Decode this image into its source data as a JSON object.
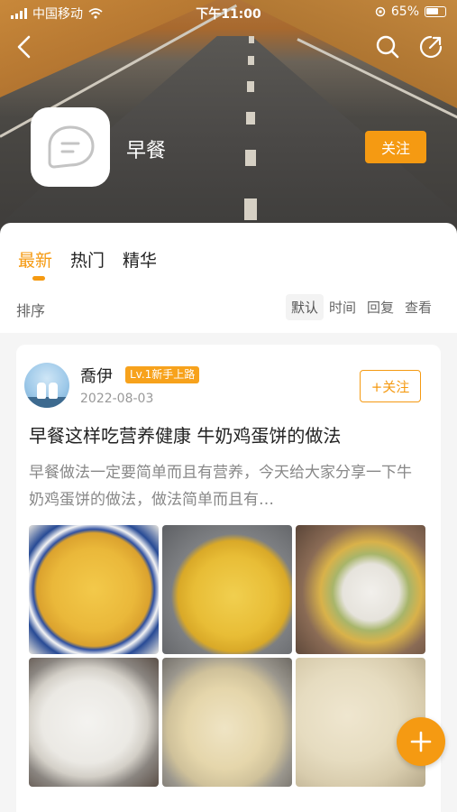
{
  "status_bar": {
    "carrier": "中国移动",
    "time": "下午11:00",
    "battery": "65%"
  },
  "group": {
    "name": "早餐",
    "follow_label": "关注"
  },
  "tabs": [
    {
      "label": "最新",
      "active": true
    },
    {
      "label": "热门",
      "active": false
    },
    {
      "label": "精华",
      "active": false
    }
  ],
  "sort": {
    "label": "排序",
    "options": [
      "默认",
      "时间",
      "回复",
      "查看"
    ],
    "selected": "默认"
  },
  "post": {
    "author": "喬伊",
    "level": "Lv.1新手上路",
    "date": "2022-08-03",
    "follow_label": "+关注",
    "title": "早餐这样吃营养健康 牛奶鸡蛋饼的做法",
    "excerpt": "早餐做法一定要简单而且有营养，今天给大家分享一下牛奶鸡蛋饼的做法，做法简单而且有…"
  },
  "icons": {
    "back": "chevron-left-icon",
    "search": "search-icon",
    "share": "share-icon",
    "group_logo": "chat-bubble-icon",
    "fab": "plus-icon"
  },
  "colors": {
    "accent": "#f59a12"
  }
}
